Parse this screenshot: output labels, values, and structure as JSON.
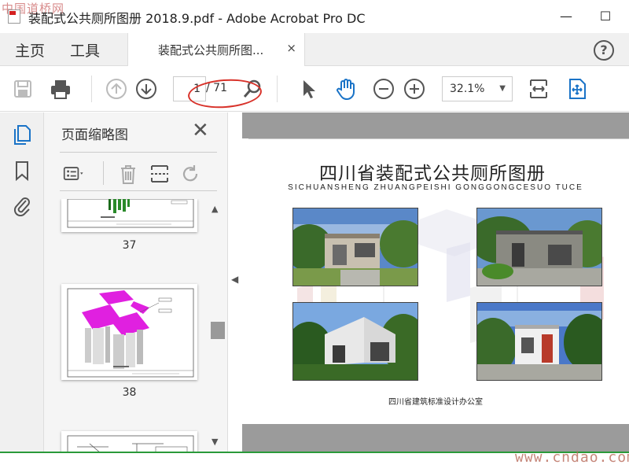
{
  "window": {
    "watermark_top": "中国道桥网",
    "title": "装配式公共厕所图册 2018.9.pdf - Adobe Acrobat Pro DC",
    "minimize": "—",
    "maximize": "☐"
  },
  "menu": {
    "home": "主页",
    "tools": "工具",
    "tab_label": "装配式公共厕所图...",
    "tab_close": "×",
    "help": "?"
  },
  "toolbar": {
    "current_page": "1",
    "total_pages": "/ 71",
    "zoom": "32.1%",
    "zoom_caret": "▼"
  },
  "panel": {
    "title": "页面缩略图",
    "close": "✕",
    "thumbnails": [
      {
        "label": "37"
      },
      {
        "label": "38"
      }
    ]
  },
  "document": {
    "title": "四川省装配式公共厕所图册",
    "subtitle": "SICHUANSHENG ZHUANGPEISHI GONGGONGCESUO TUCE",
    "footer": "四川省建筑标准设计办公室"
  },
  "watermark_bottom": "www.cndao.com",
  "colors": {
    "accent_blue": "#1a73c7",
    "annotation_red": "#d8322a",
    "doc_gray": "#9b9b9b",
    "magenta_thumb": "#e020e0",
    "bottom_green": "#2a9a3a"
  },
  "icons": [
    "save-icon",
    "print-icon",
    "page-up-icon",
    "page-down-icon",
    "search-icon",
    "select-arrow-icon",
    "hand-icon",
    "zoom-out-icon",
    "zoom-in-icon",
    "fit-page-icon",
    "full-screen-icon",
    "pages-icon",
    "bookmark-icon",
    "attachment-icon"
  ]
}
